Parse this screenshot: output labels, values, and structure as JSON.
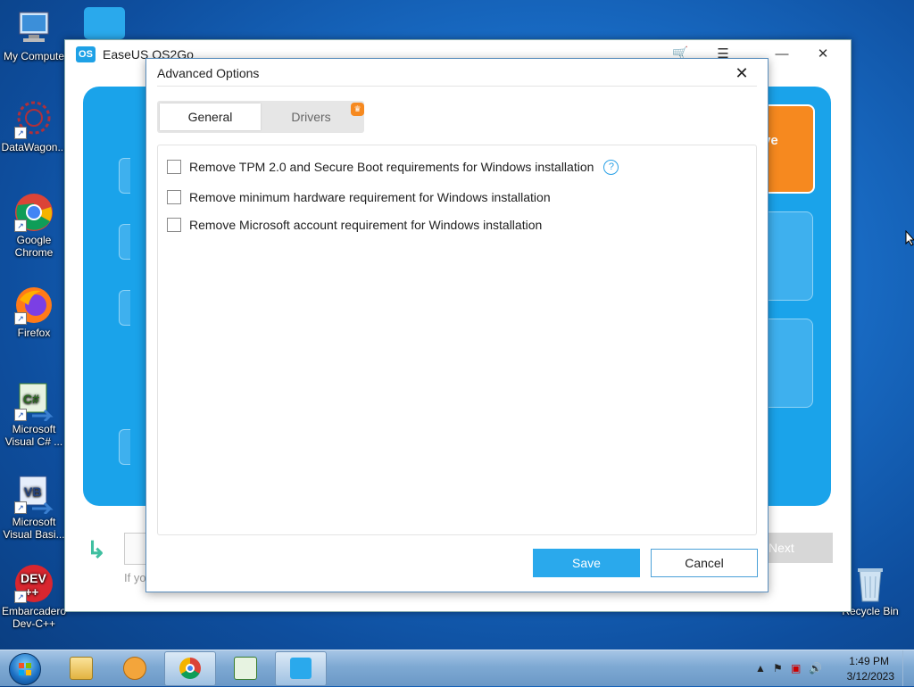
{
  "desktop": {
    "icons": [
      {
        "label": "My Compute",
        "icon": "computer-icon"
      },
      {
        "label": "DataWagon...",
        "icon": "datawagon-icon"
      },
      {
        "label": "Google Chrome",
        "icon": "chrome-icon"
      },
      {
        "label": "Firefox",
        "icon": "firefox-icon"
      },
      {
        "label": "Microsoft Visual C# ...",
        "icon": "visual-csharp-icon"
      },
      {
        "label": "Microsoft Visual Basi...",
        "icon": "visual-basic-icon"
      },
      {
        "label": "Embarcadero Dev-C++",
        "icon": "devcpp-icon"
      },
      {
        "label": "Recycle Bin",
        "icon": "recycle-bin-icon"
      }
    ]
  },
  "app": {
    "title": "EaseUS OS2Go",
    "logo_text": "OS",
    "orange_card_text": "rive",
    "next_label": "Next",
    "hint_text": "If yo"
  },
  "dialog": {
    "title": "Advanced Options",
    "tabs": [
      {
        "label": "General",
        "selected": true
      },
      {
        "label": "Drivers",
        "selected": false,
        "badge": "crown-icon"
      }
    ],
    "options": [
      {
        "label": "Remove TPM 2.0 and Secure Boot requirements for Windows installation",
        "checked": false,
        "help": true
      },
      {
        "label": "Remove minimum hardware requirement for Windows installation",
        "checked": false
      },
      {
        "label": "Remove Microsoft account requirement for Windows installation",
        "checked": false
      }
    ],
    "help_glyph": "?",
    "save_label": "Save",
    "cancel_label": "Cancel"
  },
  "taskbar": {
    "items": [
      "file-explorer-icon",
      "media-player-icon",
      "chrome-icon",
      "visual-csharp-icon",
      "easeus-os2go-icon"
    ],
    "clock_time": "1:49 PM",
    "clock_date": "3/12/2023"
  },
  "colors": {
    "accent": "#2aa9ec",
    "orange": "#f6891f",
    "desktop_blue": "#1a6fc9"
  }
}
